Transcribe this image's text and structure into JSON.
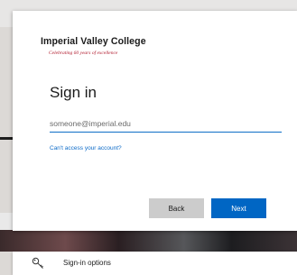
{
  "logo": {
    "name": "Imperial Valley College",
    "tagline": "Celebrating 60 years of excellence"
  },
  "signin": {
    "title": "Sign in",
    "email_placeholder": "someone@imperial.edu",
    "cant_access": "Can't access your account?",
    "back_label": "Back",
    "next_label": "Next"
  },
  "options": {
    "label": "Sign-in options",
    "icon": "key-icon"
  },
  "colors": {
    "primary_button": "#0066c4",
    "secondary_button": "#cccccc",
    "link": "#0d6bc8",
    "brand_red": "#b0182b"
  }
}
